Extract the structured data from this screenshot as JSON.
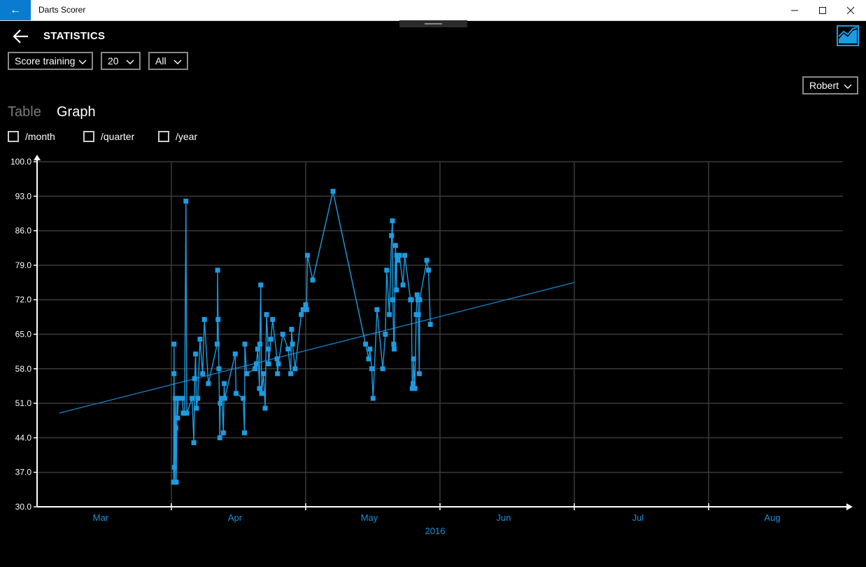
{
  "window": {
    "title": "Darts Scorer",
    "minimize": "—",
    "maximize": "☐",
    "close": "✕"
  },
  "page": {
    "title": "STATISTICS"
  },
  "filters": {
    "mode": "Score training",
    "count": "20",
    "range": "All",
    "player": "Robert"
  },
  "tabs": [
    {
      "label": "Table",
      "active": false
    },
    {
      "label": "Graph",
      "active": true
    }
  ],
  "options": [
    {
      "label": "/month",
      "checked": false
    },
    {
      "label": "/quarter",
      "checked": false
    },
    {
      "label": "/year",
      "checked": false
    }
  ],
  "chart_data": {
    "type": "line",
    "title": "",
    "xlabel": "2016",
    "ylabel": "",
    "ylim": [
      30,
      100
    ],
    "y_ticks": [
      "100.0",
      "93.0",
      "86.0",
      "79.0",
      "72.0",
      "65.0",
      "58.0",
      "51.0",
      "44.0",
      "37.0",
      "30.0"
    ],
    "x_tick_labels": [
      "Mar",
      "Apr",
      "May",
      "Jun",
      "Jul",
      "Aug"
    ],
    "grid": true,
    "colors": {
      "series": "#1e9be0",
      "trend": "#1777b8",
      "grid": "#3a3a3a",
      "axis": "#ffffff",
      "x_labels": "#1e8fd6"
    },
    "series": [
      {
        "values": [
          [
            31.0,
            35
          ],
          [
            31.1,
            63
          ],
          [
            31.1,
            57
          ],
          [
            31.2,
            38
          ],
          [
            31.3,
            35
          ],
          [
            31.4,
            52
          ],
          [
            31.5,
            46
          ],
          [
            31.6,
            35
          ],
          [
            31.8,
            52
          ],
          [
            31.9,
            48
          ],
          [
            32.1,
            52
          ],
          [
            33.0,
            52
          ],
          [
            33.2,
            49
          ],
          [
            33.5,
            49
          ],
          [
            33.8,
            92
          ],
          [
            34.0,
            49
          ],
          [
            35.2,
            52
          ],
          [
            35.6,
            43
          ],
          [
            35.8,
            56
          ],
          [
            36.0,
            61
          ],
          [
            36.2,
            50
          ],
          [
            36.5,
            52
          ],
          [
            37.0,
            64
          ],
          [
            37.6,
            57
          ],
          [
            38.0,
            68
          ],
          [
            38.9,
            55
          ],
          [
            40.9,
            63
          ],
          [
            41.0,
            78
          ],
          [
            41.1,
            68
          ],
          [
            41.3,
            58
          ],
          [
            41.5,
            44
          ],
          [
            41.6,
            51
          ],
          [
            42.0,
            52
          ],
          [
            42.3,
            45
          ],
          [
            42.5,
            55
          ],
          [
            42.6,
            52
          ],
          [
            45.0,
            61
          ],
          [
            45.2,
            53
          ],
          [
            46.8,
            52
          ],
          [
            47.1,
            45
          ],
          [
            47.2,
            63
          ],
          [
            47.6,
            57
          ],
          [
            49.5,
            58
          ],
          [
            49.8,
            59
          ],
          [
            50.1,
            62
          ],
          [
            50.5,
            54
          ],
          [
            50.6,
            63
          ],
          [
            50.8,
            75
          ],
          [
            51.0,
            53
          ],
          [
            51.4,
            57
          ],
          [
            51.8,
            50
          ],
          [
            52.1,
            69
          ],
          [
            52.5,
            62
          ],
          [
            52.6,
            59
          ],
          [
            53.1,
            64
          ],
          [
            53.5,
            68
          ],
          [
            54.5,
            60
          ],
          [
            54.6,
            57
          ],
          [
            54.8,
            59
          ],
          [
            55.8,
            65
          ],
          [
            57.0,
            62
          ],
          [
            57.6,
            57
          ],
          [
            57.8,
            66
          ],
          [
            58.0,
            63
          ],
          [
            58.6,
            58
          ],
          [
            60.0,
            69
          ],
          [
            60.4,
            70
          ],
          [
            61.0,
            71
          ],
          [
            61.2,
            70
          ],
          [
            61.4,
            81
          ],
          [
            62.6,
            76
          ],
          [
            67.2,
            94
          ],
          [
            74.6,
            63
          ],
          [
            75.3,
            60
          ],
          [
            75.6,
            62
          ],
          [
            76.0,
            58
          ],
          [
            76.3,
            52
          ],
          [
            77.2,
            70
          ],
          [
            78.5,
            58
          ],
          [
            79.1,
            65
          ],
          [
            79.4,
            78
          ],
          [
            80.0,
            69
          ],
          [
            80.5,
            85
          ],
          [
            80.7,
            88
          ],
          [
            80.8,
            72
          ],
          [
            81.0,
            63
          ],
          [
            81.1,
            62
          ],
          [
            81.4,
            83
          ],
          [
            81.6,
            74
          ],
          [
            81.7,
            81
          ],
          [
            81.9,
            80
          ],
          [
            82.3,
            81
          ],
          [
            83.1,
            75
          ],
          [
            83.5,
            81
          ],
          [
            84.8,
            72
          ],
          [
            85.0,
            72
          ],
          [
            85.2,
            54
          ],
          [
            85.4,
            55
          ],
          [
            85.5,
            60
          ],
          [
            85.8,
            54
          ],
          [
            86.1,
            69
          ],
          [
            86.3,
            73
          ],
          [
            86.5,
            72
          ],
          [
            86.6,
            69
          ],
          [
            86.8,
            57
          ],
          [
            86.9,
            72
          ],
          [
            88.5,
            80
          ],
          [
            88.9,
            78
          ],
          [
            89.3,
            67
          ]
        ]
      }
    ],
    "trend": [
      [
        5,
        49
      ],
      [
        122,
        75.5
      ]
    ]
  }
}
